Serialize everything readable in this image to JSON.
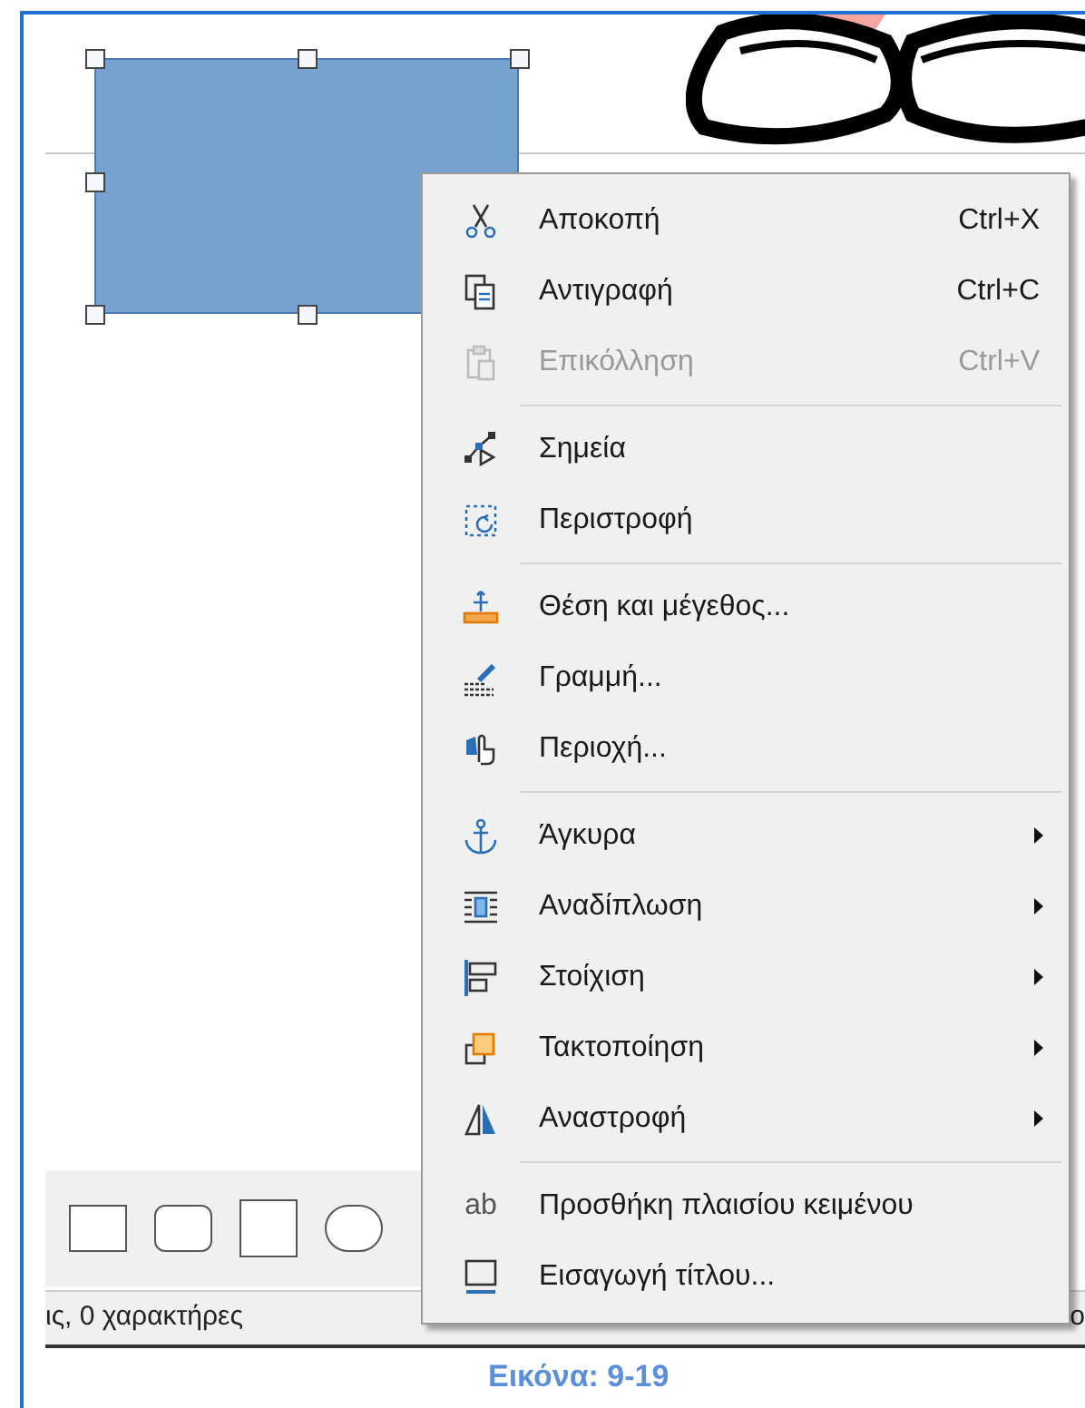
{
  "menu": {
    "sections": [
      {
        "items": [
          {
            "label": "Αποκοπή",
            "shortcut": "Ctrl+X",
            "disabled": false,
            "submenu": false
          },
          {
            "label": "Αντιγραφή",
            "shortcut": "Ctrl+C",
            "disabled": false,
            "submenu": false
          },
          {
            "label": "Επικόλληση",
            "shortcut": "Ctrl+V",
            "disabled": true,
            "submenu": false
          }
        ]
      },
      {
        "items": [
          {
            "label": "Σημεία",
            "disabled": false,
            "submenu": false
          },
          {
            "label": "Περιστροφή",
            "disabled": false,
            "submenu": false
          }
        ]
      },
      {
        "items": [
          {
            "label": "Θέση και μέγεθος...",
            "disabled": false,
            "submenu": false
          },
          {
            "label": "Γραμμή...",
            "disabled": false,
            "submenu": false
          },
          {
            "label": "Περιοχή...",
            "disabled": false,
            "submenu": false
          }
        ]
      },
      {
        "items": [
          {
            "label": "Άγκυρα",
            "disabled": false,
            "submenu": true
          },
          {
            "label": "Αναδίπλωση",
            "disabled": false,
            "submenu": true
          },
          {
            "label": "Στοίχιση",
            "disabled": false,
            "submenu": true
          },
          {
            "label": "Τακτοποίηση",
            "disabled": false,
            "submenu": true
          },
          {
            "label": "Αναστροφή",
            "disabled": false,
            "submenu": true
          }
        ]
      },
      {
        "items": [
          {
            "label": "Προσθήκη πλαισίου κειμένου",
            "icon_text": "ab",
            "disabled": false,
            "submenu": false
          },
          {
            "label": "Εισαγωγή τίτλου...",
            "disabled": false,
            "submenu": false
          }
        ]
      }
    ]
  },
  "status_bar": {
    "left": "ις, 0 χαρακτήρες",
    "right": "ο"
  },
  "caption": "Εικόνα: 9-19"
}
